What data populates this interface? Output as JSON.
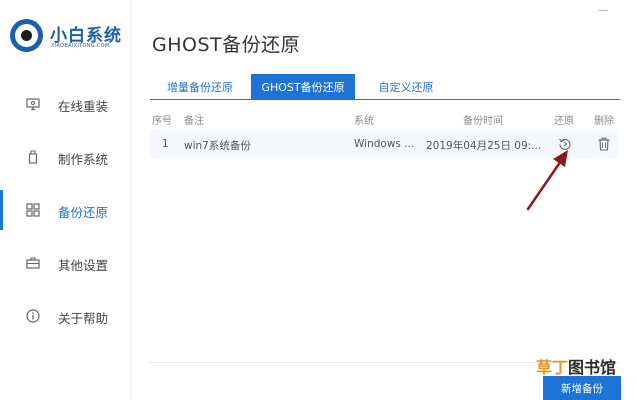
{
  "app": {
    "name": "小白系统",
    "subtitle": "XIAOBAIXITONG.COM"
  },
  "sidebar": {
    "items": [
      {
        "label": "在线重装",
        "icon": "monitor-icon",
        "active": false
      },
      {
        "label": "制作系统",
        "icon": "usb-drive-icon",
        "active": false
      },
      {
        "label": "备份还原",
        "icon": "backup-grid-icon",
        "active": true
      },
      {
        "label": "其他设置",
        "icon": "briefcase-icon",
        "active": false
      },
      {
        "label": "关于帮助",
        "icon": "info-icon",
        "active": false
      }
    ]
  },
  "page": {
    "title": "GHOST备份还原"
  },
  "tabs": [
    {
      "label": "增量备份还原",
      "active": false
    },
    {
      "label": "GHOST备份还原",
      "active": true
    },
    {
      "label": "自定义还原",
      "active": false
    }
  ],
  "table": {
    "headers": [
      "序号",
      "备注",
      "系统",
      "备份时间",
      "还原",
      "删除"
    ],
    "rows": [
      {
        "index": "1",
        "note": "win7系统备份",
        "system": "Windows ...",
        "time": "2019年04月25日 09:..."
      }
    ],
    "restore_icon": "restore-icon",
    "delete_icon": "trash-icon"
  },
  "actions": {
    "add_backup": "新增备份"
  },
  "watermark": {
    "part1": "草丁",
    "part2": "图书馆"
  },
  "colors": {
    "accent": "#1e74d6",
    "brand": "#1b5fae",
    "arrow": "#8b1a1a",
    "watermark_orange": "#e8951c"
  }
}
